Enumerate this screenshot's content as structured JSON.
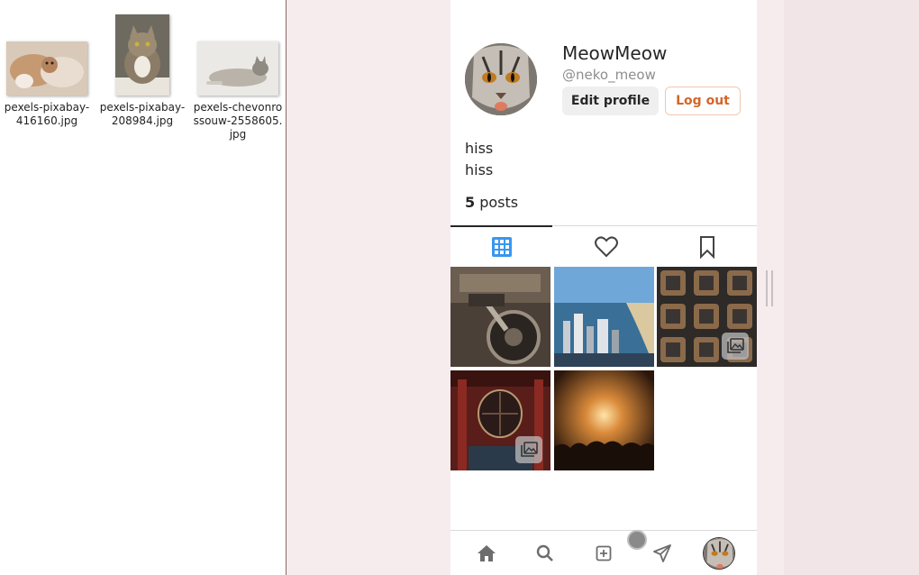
{
  "files": [
    {
      "name": "pexels-pixabay-416160.jpg"
    },
    {
      "name": "pexels-pixabay-208984.jpg"
    },
    {
      "name": "pexels-chevonrossouw-2558605.jpg"
    }
  ],
  "profile": {
    "username": "MeowMeow",
    "handle": "@neko_meow",
    "edit_label": "Edit profile",
    "logout_label": "Log out",
    "bio_lines": [
      "hiss",
      "hiss"
    ],
    "post_count": "5",
    "posts_label": " posts"
  },
  "tabs": [
    {
      "icon": "grid-icon",
      "active": true
    },
    {
      "icon": "heart-icon",
      "active": false
    },
    {
      "icon": "bookmark-icon",
      "active": false
    }
  ],
  "posts": [
    {
      "subject": "motorcycle",
      "multi": false
    },
    {
      "subject": "city-coast",
      "multi": false
    },
    {
      "subject": "aerial-city",
      "multi": true
    },
    {
      "subject": "temple-lantern",
      "multi": true
    },
    {
      "subject": "concert",
      "multi": false
    }
  ],
  "bottom_nav": [
    {
      "icon": "home-icon"
    },
    {
      "icon": "search-icon"
    },
    {
      "icon": "add-post-icon"
    },
    {
      "icon": "send-icon"
    },
    {
      "icon": "profile-avatar-icon"
    }
  ],
  "colors": {
    "accent": "#3897f0",
    "logout": "#d4652a",
    "background": "#f6ecee"
  }
}
